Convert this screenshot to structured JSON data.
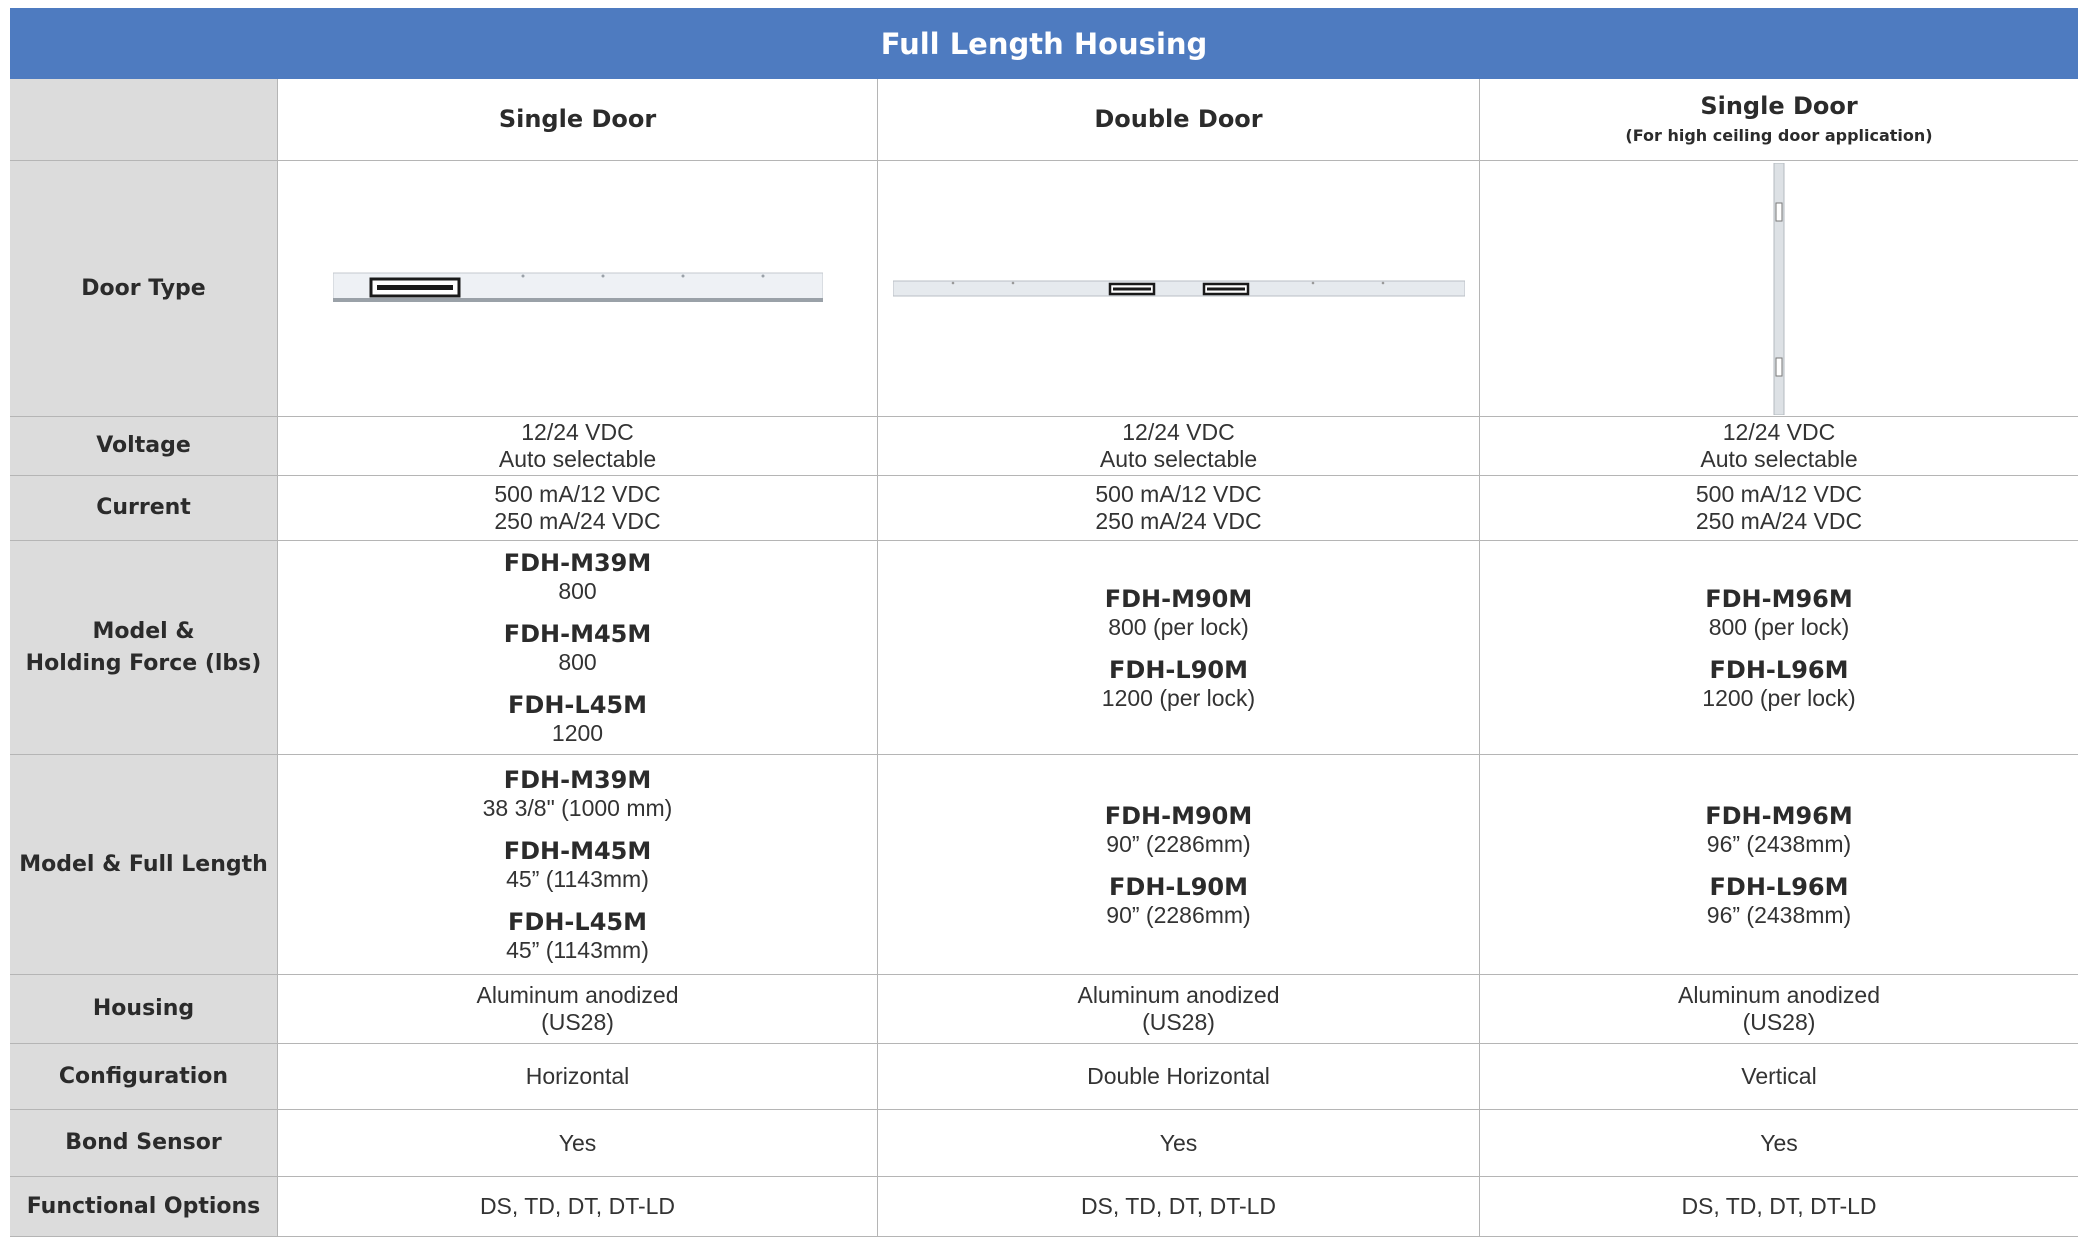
{
  "title": "Full Length Housing",
  "columns": [
    {
      "title": "Single Door",
      "subtitle": ""
    },
    {
      "title": "Double Door",
      "subtitle": ""
    },
    {
      "title": "Single Door",
      "subtitle": "(For high ceiling door application)"
    }
  ],
  "row_labels": {
    "door_type": "Door Type",
    "voltage": "Voltage",
    "current": "Current",
    "holding_1": "Model &",
    "holding_2": "Holding Force (lbs)",
    "length": "Model & Full Length",
    "housing": "Housing",
    "configuration": "Configuration",
    "bond_sensor": "Bond Sensor",
    "functional_options": "Functional Options"
  },
  "voltage": [
    [
      "12/24 VDC",
      "Auto selectable"
    ],
    [
      "12/24 VDC",
      "Auto selectable"
    ],
    [
      "12/24 VDC",
      "Auto selectable"
    ]
  ],
  "current": [
    [
      "500 mA/12 VDC",
      "250 mA/24 VDC"
    ],
    [
      "500 mA/12 VDC",
      "250 mA/24 VDC"
    ],
    [
      "500 mA/12 VDC",
      "250 mA/24 VDC"
    ]
  ],
  "holding": [
    [
      {
        "model": "FDH-M39M",
        "value": "800"
      },
      {
        "model": "FDH-M45M",
        "value": "800"
      },
      {
        "model": "FDH-L45M",
        "value": "1200"
      }
    ],
    [
      {
        "model": "FDH-M90M",
        "value": "800 (per lock)"
      },
      {
        "model": "FDH-L90M",
        "value": "1200 (per lock)"
      }
    ],
    [
      {
        "model": "FDH-M96M",
        "value": "800 (per lock)"
      },
      {
        "model": "FDH-L96M",
        "value": "1200 (per lock)"
      }
    ]
  ],
  "length": [
    [
      {
        "model": "FDH-M39M",
        "value": "38 3/8\" (1000 mm)"
      },
      {
        "model": "FDH-M45M",
        "value": "45” (1143mm)"
      },
      {
        "model": "FDH-L45M",
        "value": "45” (1143mm)"
      }
    ],
    [
      {
        "model": "FDH-M90M",
        "value": "90” (2286mm)"
      },
      {
        "model": "FDH-L90M",
        "value": "90” (2286mm)"
      }
    ],
    [
      {
        "model": "FDH-M96M",
        "value": "96” (2438mm)"
      },
      {
        "model": "FDH-L96M",
        "value": "96” (2438mm)"
      }
    ]
  ],
  "housing": [
    [
      "Aluminum anodized",
      "(US28)"
    ],
    [
      "Aluminum anodized",
      "(US28)"
    ],
    [
      "Aluminum anodized",
      "(US28)"
    ]
  ],
  "configuration": [
    "Horizontal",
    "Double Horizontal",
    "Vertical"
  ],
  "bond_sensor": [
    "Yes",
    "Yes",
    "Yes"
  ],
  "functional_options": [
    "DS, TD, DT, DT-LD",
    "DS, TD, DT, DT-LD",
    "DS, TD, DT, DT-LD"
  ],
  "colors": {
    "header_bg": "#4e7bc0",
    "row_header_bg": "#dcdcdc",
    "border": "#b5b5b5"
  }
}
